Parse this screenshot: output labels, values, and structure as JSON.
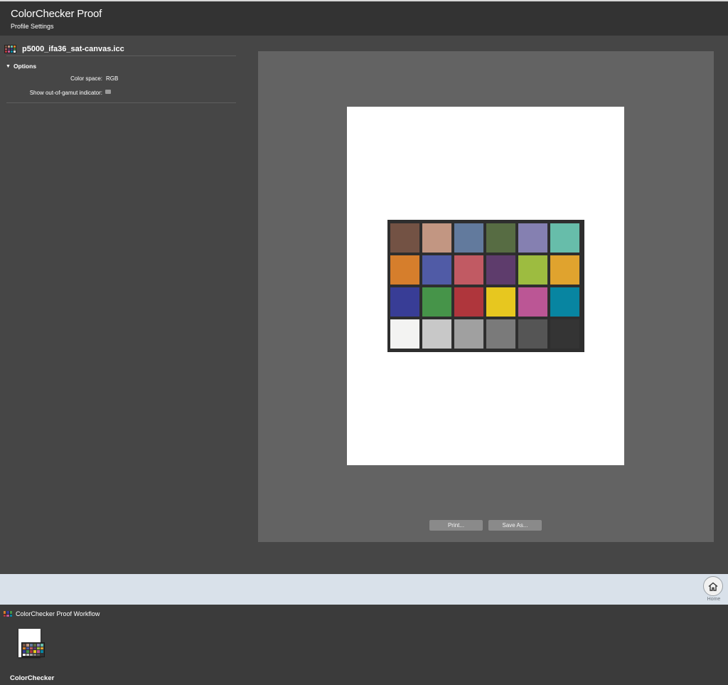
{
  "header": {
    "title": "ColorChecker Proof",
    "subtitle": "Profile Settings"
  },
  "sidebar": {
    "profile_name": "p5000_ifa36_sat-canvas.icc",
    "options_label": "Options",
    "color_space_label": "Color space:",
    "color_space_value": "RGB",
    "gamut_label": "Show out-of-gamut indicator:",
    "gamut_checked": false
  },
  "preview": {
    "print_label": "Print...",
    "save_label": "Save As...",
    "patches": [
      "#735244",
      "#c29682",
      "#627a9d",
      "#576c43",
      "#8580b1",
      "#67bdaa",
      "#d67e2c",
      "#505ba6",
      "#c15a63",
      "#5e3c6c",
      "#9dbc40",
      "#e0a32e",
      "#383d96",
      "#469449",
      "#af363c",
      "#e7c71f",
      "#bb5695",
      "#0885a1",
      "#f3f3f2",
      "#c8c8c8",
      "#a0a0a0",
      "#7a7a7a",
      "#555555",
      "#343434"
    ]
  },
  "home": {
    "label": "Home"
  },
  "workflow": {
    "title": "ColorChecker Proof Workflow",
    "item_label": "ColorChecker"
  }
}
